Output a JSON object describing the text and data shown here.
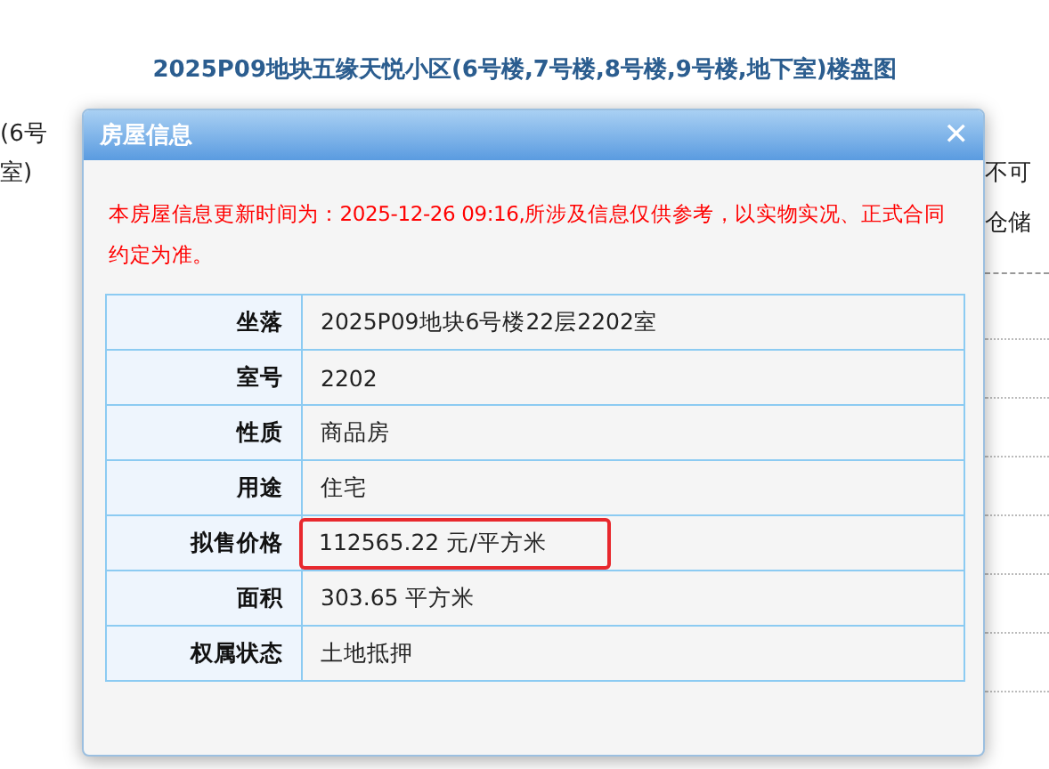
{
  "page": {
    "title": "2025P09地块五缘天悦小区(6号楼,7号楼,8号楼,9号楼,地下室)楼盘图",
    "left_texts": [
      "(6号",
      "室)"
    ],
    "right_texts": [
      "不可",
      "仓储"
    ]
  },
  "dialog": {
    "title": "房屋信息",
    "close": "✕",
    "notice": "本房屋信息更新时间为：2025-12-26 09:16,所涉及信息仅供参考，以实物实况、正式合同约定为准。",
    "rows": [
      {
        "label": "坐落",
        "value": "2025P09地块6号楼22层2202室",
        "highlighted": false
      },
      {
        "label": "室号",
        "value": "2202",
        "highlighted": false
      },
      {
        "label": "性质",
        "value": "商品房",
        "highlighted": false
      },
      {
        "label": "用途",
        "value": "住宅",
        "highlighted": false
      },
      {
        "label": "拟售价格",
        "value": "112565.22 元/平方米",
        "highlighted": true
      },
      {
        "label": "面积",
        "value": "303.65 平方米",
        "highlighted": false
      },
      {
        "label": "权属状态",
        "value": "土地抵押",
        "highlighted": false
      }
    ]
  }
}
